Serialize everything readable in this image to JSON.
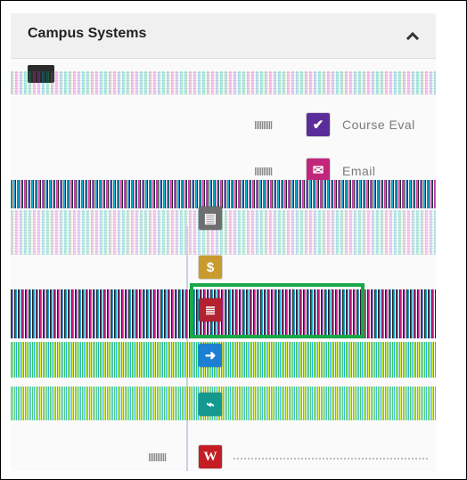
{
  "panel": {
    "title": "Campus Systems",
    "collapse_icon": "chevron-up-icon"
  },
  "apps": [
    {
      "id": "course-evaluations",
      "label": "Course Eval",
      "icon": "checkmark-icon",
      "color": "#5b2d9a",
      "glyph": "✔"
    },
    {
      "id": "email",
      "label": "Email",
      "icon": "envelope-icon",
      "color": "#c1267a",
      "glyph": "✉"
    },
    {
      "id": "document",
      "label": "",
      "icon": "document-icon",
      "color": "#6e6e6e",
      "glyph": "▤"
    },
    {
      "id": "finance",
      "label": "",
      "icon": "money-bag-icon",
      "color": "#c99a2e",
      "glyph": "$"
    },
    {
      "id": "student-profile",
      "label": "",
      "icon": "id-card-icon",
      "color": "#b3222e",
      "glyph": "≣"
    },
    {
      "id": "portal",
      "label": "",
      "icon": "arrow-screen-icon",
      "color": "#1d7fd1",
      "glyph": "➜"
    },
    {
      "id": "analytics",
      "label": "",
      "icon": "chart-icon",
      "color": "#14998f",
      "glyph": "⌁"
    },
    {
      "id": "workday",
      "label": "",
      "icon": "w-logo-icon",
      "color": "#c41e24",
      "glyph": "W"
    }
  ]
}
